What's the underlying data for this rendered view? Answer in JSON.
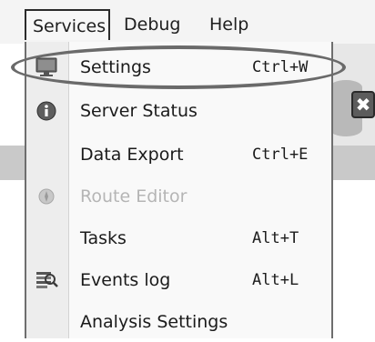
{
  "menubar": {
    "items": [
      {
        "label": "Services"
      },
      {
        "label": "Debug"
      },
      {
        "label": "Help"
      }
    ]
  },
  "background": {
    "close_glyph": "✖"
  },
  "menu": {
    "items": [
      {
        "label": "Settings",
        "shortcut": "Ctrl+W",
        "icon": "monitor-icon",
        "enabled": true
      },
      {
        "label": "Server Status",
        "shortcut": "",
        "icon": "info-icon",
        "enabled": true
      },
      {
        "label": "Data Export",
        "shortcut": "Ctrl+E",
        "icon": "",
        "enabled": true
      },
      {
        "label": "Route Editor",
        "shortcut": "",
        "icon": "compass-icon",
        "enabled": false
      },
      {
        "label": "Tasks",
        "shortcut": "Alt+T",
        "icon": "",
        "enabled": true
      },
      {
        "label": "Events log",
        "shortcut": "Alt+L",
        "icon": "log-search-icon",
        "enabled": true
      },
      {
        "label": "Analysis Settings",
        "shortcut": "",
        "icon": "",
        "enabled": true
      }
    ]
  },
  "colors": {
    "menu_background": "#f9f9f9",
    "gutter": "#ededed",
    "disabled_text": "#b5b5b5",
    "highlight_ring": "#6a6a6a"
  }
}
